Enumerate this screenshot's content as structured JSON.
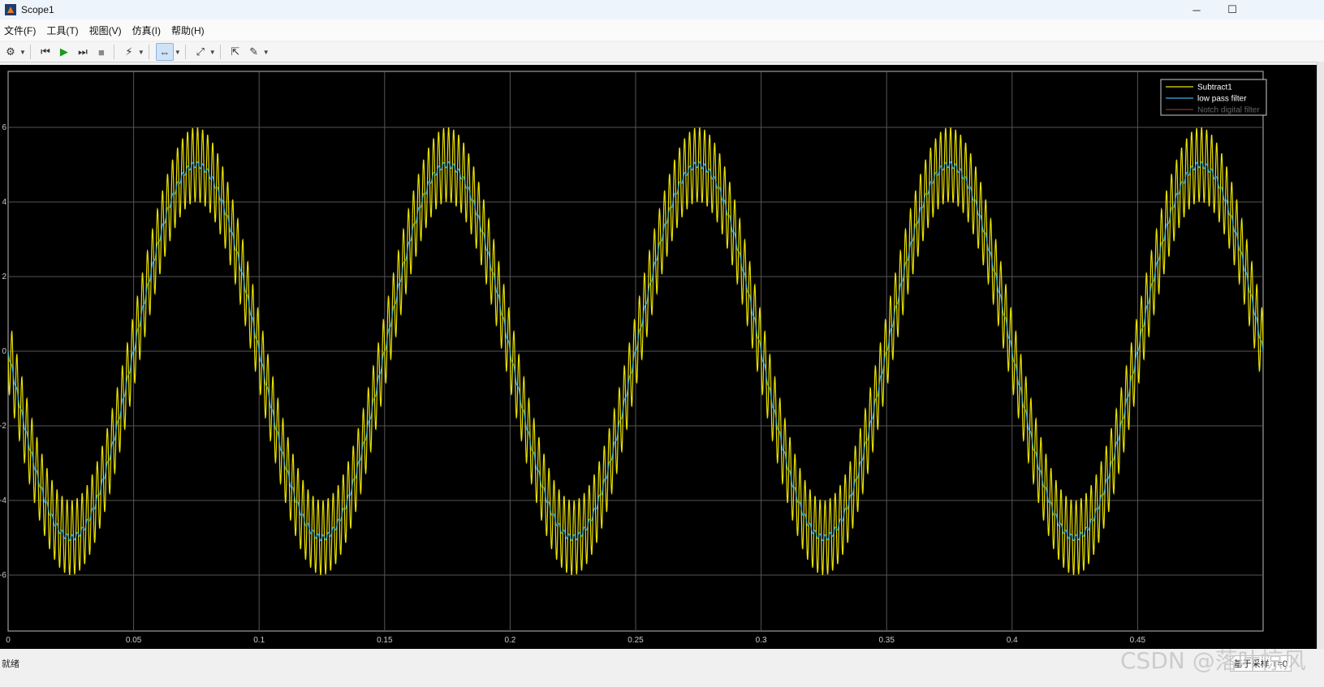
{
  "window": {
    "title": "Scope1",
    "minimize_glyph": "─",
    "maximize_glyph": "☐"
  },
  "menu": {
    "items": [
      "文件(F)",
      "工具(T)",
      "视图(V)",
      "仿真(I)",
      "帮助(H)"
    ]
  },
  "toolbar": {
    "icons": [
      "settings-icon",
      "step-back-icon",
      "run-icon",
      "step-forward-icon",
      "stop-icon",
      "signal-select-icon",
      "zoom-icon",
      "scale-axes-icon",
      "restore-icon",
      "triggers-icon"
    ]
  },
  "status": {
    "left_text": "就绪",
    "right_text": "基于采样",
    "right_extra": "T=0"
  },
  "watermark": "CSDN @落叶惊风",
  "chart_data": {
    "type": "line",
    "xlim": [
      0,
      0.5
    ],
    "ylim": [
      -7.5,
      7.5
    ],
    "x_ticks": [
      "0",
      "0.05",
      "0.1",
      "0.15",
      "0.2",
      "0.25",
      "0.3",
      "0.35",
      "0.4",
      "0.45"
    ],
    "x_tick_values": [
      0,
      0.05,
      0.1,
      0.15,
      0.2,
      0.25,
      0.3,
      0.35,
      0.4,
      0.45
    ],
    "y_ticks": [
      "-6",
      "-4",
      "-2",
      "0",
      "2",
      "4",
      "6"
    ],
    "y_tick_values": [
      -6,
      -4,
      -2,
      0,
      2,
      4,
      6
    ],
    "grid": true,
    "legend_position": "top-right",
    "series": [
      {
        "name": "Subtract1",
        "color": "#e8e000",
        "description": "sine amplitude 5, period 0.1, minus sine; plus high frequency ripple amplitude 1 (500 Hz)",
        "base_amplitude": 5,
        "base_frequency_hz": 10,
        "ripple_amplitude": 1,
        "ripple_frequency_hz": 500
      },
      {
        "name": "low pass filter",
        "color": "#3ab0e8",
        "base_amplitude": 5,
        "base_frequency_hz": 10,
        "ripple_amplitude": 0.08,
        "ripple_frequency_hz": 500
      },
      {
        "name": "Notch digital filter",
        "color": "#8a3030",
        "base_amplitude": 0,
        "base_frequency_hz": 10,
        "ripple_amplitude": 0,
        "ripple_frequency_hz": 500
      }
    ]
  }
}
